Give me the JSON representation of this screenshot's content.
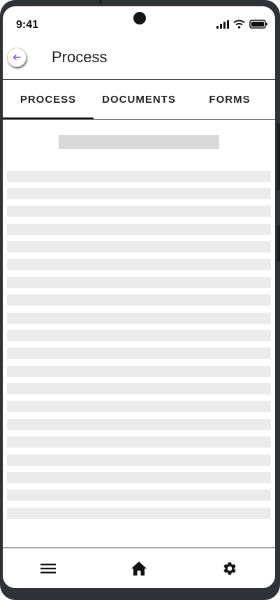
{
  "status_bar": {
    "time": "9:41"
  },
  "header": {
    "title": "Process",
    "back_icon": "arrow-left-icon",
    "accent_color": "#8a3ffc"
  },
  "tabs": [
    {
      "label": "PROCESS",
      "active": true
    },
    {
      "label": "DOCUMENTS",
      "active": false
    },
    {
      "label": "FORMS",
      "active": false
    }
  ],
  "content": {
    "state": "loading-skeleton",
    "skeleton_line_count": 20
  },
  "bottom_nav": [
    {
      "icon": "menu-icon"
    },
    {
      "icon": "home-icon"
    },
    {
      "icon": "settings-icon"
    }
  ]
}
